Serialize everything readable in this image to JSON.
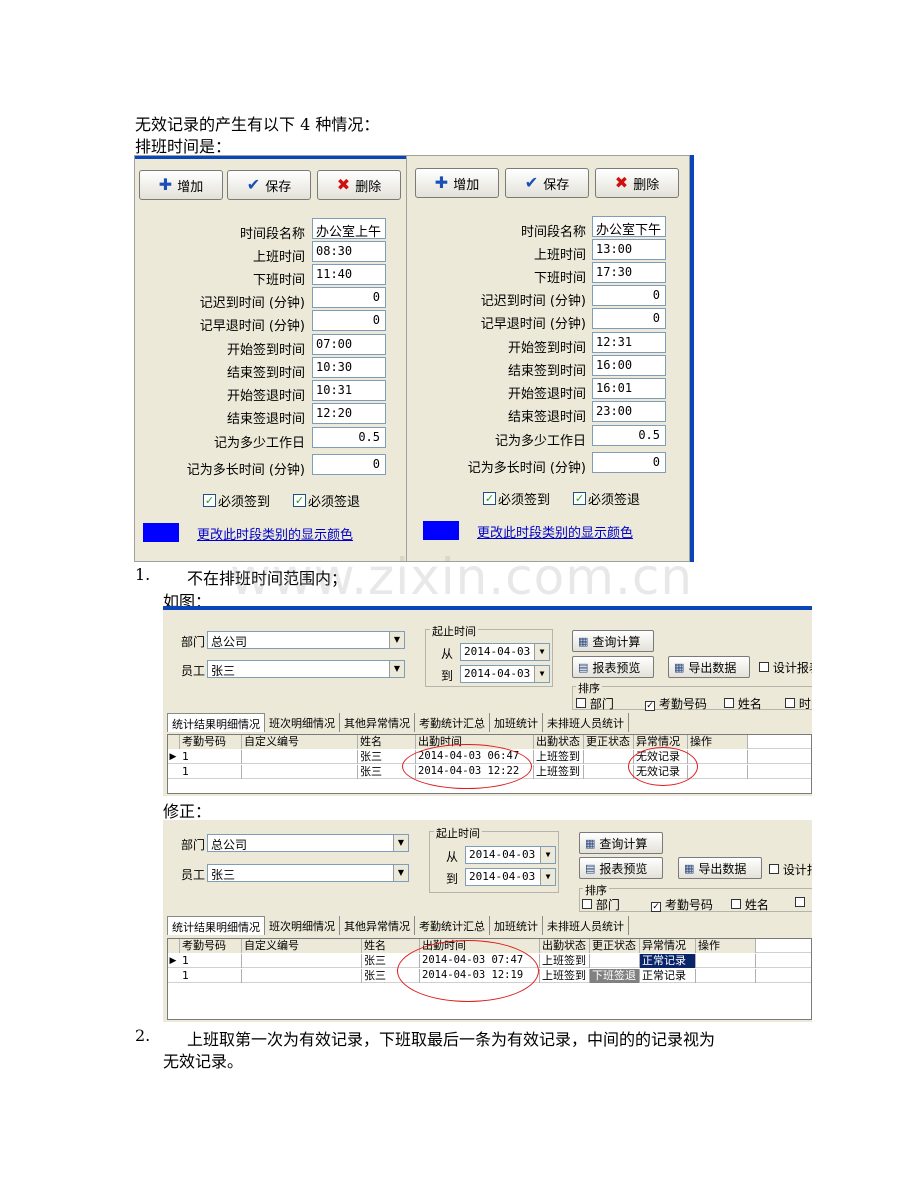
{
  "text": {
    "intro": "无效记录的产生有以下 4 种情况：",
    "schedule": "排班时间是：",
    "item1_num": "1.",
    "item1_text": "不在排班时间范围内；",
    "as_shown": "如图：",
    "fixed": "修正：",
    "item2_num": "2.",
    "item2_line1": "上班取第一次为有效记录，下班取最后一条为有效记录，中间的的记录视为",
    "item2_line2": "无效记录。"
  },
  "watermark": "www.zixin.com.cn",
  "shift_panels": {
    "buttons": {
      "add": "增加",
      "save": "保存",
      "delete": "删除"
    },
    "icons": {
      "add": "plus-icon",
      "save": "checkmark-icon",
      "delete": "x-icon"
    },
    "labels": {
      "name": "时间段名称",
      "on_time": "上班时间",
      "off_time": "下班时间",
      "late": "记迟到时间 (分钟)",
      "early": "记早退时间 (分钟)",
      "checkin_start": "开始签到时间",
      "checkin_end": "结束签到时间",
      "checkout_start": "开始签退时间",
      "checkout_end": "结束签退时间",
      "workdays": "记为多少工作日",
      "duration": "记为多长时间 (分钟)",
      "must_in": "必须签到",
      "must_out": "必须签退",
      "color_link": "更改此时段类别的显示颜色"
    },
    "display_color": "#0000ff",
    "morning": {
      "name": "办公室上午",
      "on_time": "08:30",
      "off_time": "11:40",
      "late": "0",
      "early": "0",
      "checkin_start": "07:00",
      "checkin_end": "10:30",
      "checkout_start": "10:31",
      "checkout_end": "12:20",
      "workdays": "0.5",
      "duration": "0",
      "must_in": true,
      "must_out": true
    },
    "afternoon": {
      "name": "办公室下午",
      "on_time": "13:00",
      "off_time": "17:30",
      "late": "0",
      "early": "0",
      "checkin_start": "12:31",
      "checkin_end": "16:00",
      "checkout_start": "16:01",
      "checkout_end": "23:00",
      "workdays": "0.5",
      "duration": "0",
      "must_in": true,
      "must_out": true
    }
  },
  "query": {
    "dept_label": "部门",
    "dept_value": "总公司",
    "emp_label": "员工",
    "emp_value": "张三",
    "period_title": "起止时间",
    "from_label": "从",
    "to_label": "到",
    "from_date": "2014-04-03",
    "to_date": "2014-04-03",
    "btn_calc": "查询计算",
    "btn_preview": "报表预览",
    "btn_export": "导出数据",
    "design_label": "设计报表",
    "sort_title": "排序",
    "sort_dept": "部门",
    "sort_code": "考勤号码",
    "sort_name": "姓名",
    "sort_time": "时间",
    "tabs": [
      "统计结果明细情况",
      "班次明细情况",
      "其他异常情况",
      "考勤统计汇总",
      "加班统计",
      "未排班人员统计"
    ],
    "columns": [
      "考勤号码",
      "自定义编号",
      "姓名",
      "出勤时间",
      "出勤状态",
      "更正状态",
      "异常情况",
      "操作"
    ]
  },
  "grid_before": [
    {
      "code": "1",
      "custom": "",
      "name": "张三",
      "time": "2014-04-03 06:47",
      "status": "上班签到",
      "corrected": "",
      "exception": "无效记录",
      "action": ""
    },
    {
      "code": "1",
      "custom": "",
      "name": "张三",
      "time": "2014-04-03 12:22",
      "status": "上班签到",
      "corrected": "",
      "exception": "无效记录",
      "action": ""
    }
  ],
  "grid_after": [
    {
      "code": "1",
      "custom": "",
      "name": "张三",
      "time": "2014-04-03 07:47",
      "status": "上班签到",
      "corrected": "",
      "exception": "正常记录",
      "action": ""
    },
    {
      "code": "1",
      "custom": "",
      "name": "张三",
      "time": "2014-04-03 12:19",
      "status": "上班签到",
      "corrected": "下班签退",
      "exception": "正常记录",
      "action": ""
    }
  ],
  "colors": {
    "title_bar_blue": "#0b46b8",
    "highlight_blue": "#0a246a",
    "annotation_red": "#e01b1b"
  }
}
